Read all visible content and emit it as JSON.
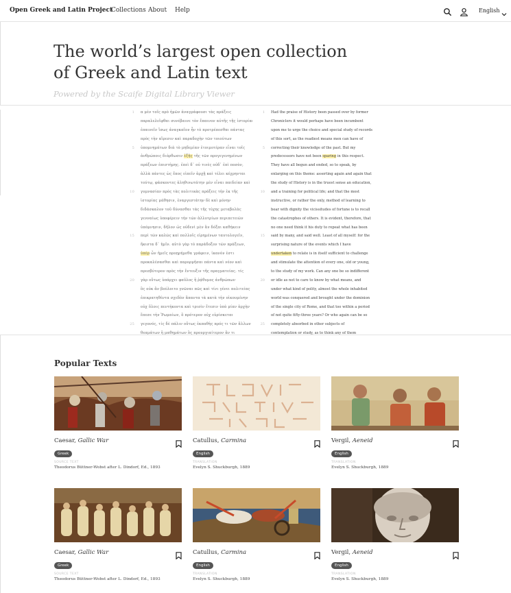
{
  "header": {
    "brand": "Open Greek and Latin Project",
    "nav": [
      "Collections",
      "About",
      "Help"
    ],
    "language": "English"
  },
  "hero": {
    "title": "The world’s largest open collection of Greek and Latin text",
    "subtitle": "Powered by the Scaife Digital Library Viewer"
  },
  "reader": {
    "greek_lines": [
      {
        "n": "1",
        "t": "α μὲν τοῖς πρὸ ἡμῶν ἀναγράφουσι τὰς πράξεις"
      },
      {
        "n": "",
        "t": "παραλελεῖφθαι συνέβαινε τὸν ἔπαινον αὐτῆς τῆς ἱστορίας"
      },
      {
        "n": "",
        "t": "ἐπαινεῖν ἴσως ἀναγκαῖον ἦν τὸ προτρέπεσθαι πάντας"
      },
      {
        "n": "",
        "t": "πρὸς τὴν αἵρεσιν καὶ παραδοχὴν τῶν τοιούτων"
      },
      {
        "n": "5",
        "t": "ὑπομνημάτων διὰ τὸ μηδεμίαν ἑτοιμοτέραν εἶναι τοῖς"
      },
      {
        "n": "",
        "t": "ἀνθρώποις διόρθωσιν",
        "h": "ἐξῆς",
        "t2": "τῆς τῶν προγεγενημένων"
      },
      {
        "n": "",
        "t": "πράξεων ἐπιστήμης. ἐπεὶ δ᾽ οὐ τινὲς οὐδ᾽ ἐπὶ ποσὸν,"
      },
      {
        "n": "",
        "t": "ἀλλὰ πάντες ὡς ἔπος εἰπεῖν ἀρχῇ καὶ τέλει κέχρηνται"
      },
      {
        "n": "",
        "t": "τούτῳ, φάσκοντες ἀληθινωτάτην μὲν εἶναι παιδείαν καὶ"
      },
      {
        "n": "10",
        "t": "γυμνασίαν πρὸς τὰς πολιτικὰς πράξεις τὴν ἐκ τῆς"
      },
      {
        "n": "",
        "t": "ἱστορίας μάθησιν, ἐναργεστάτην δὲ καὶ μόνην"
      },
      {
        "n": "",
        "t": "διδάσκαλον τοῦ δύνασθαι τὰς τῆς τύχης μεταβολὰς"
      },
      {
        "n": "",
        "t": "γενναίως ὑποφέρειν τὴν τῶν ἀλλοτρίων περιπετειῶν"
      },
      {
        "n": "",
        "t": "ὑπόμνησιν, δῆλον ὡς οὐδενὶ μὲν ἂν δόξαι καθήκειν"
      },
      {
        "n": "15",
        "t": "περὶ τῶν καλῶς καὶ πολλοῖς εἰρημένων ταυτολογεῖν,"
      },
      {
        "n": "",
        "t": "ἥκιστα δ᾽ ἡμῖν. αὐτὸ γὰρ τὸ παράδοξον τῶν πράξεων,"
      },
      {
        "n": "",
        "t": "",
        "h": "ὑπὲρ",
        "t2": "ὧν ἡμεῖς προῃρήμεθα γράφειν, ἱκανόν ἐστι"
      },
      {
        "n": "",
        "t": "προκαλέσασθαι καὶ παρορμῆσαι πάντα καὶ νέον καὶ"
      },
      {
        "n": "",
        "t": "πρεσβύτερον πρὸς τὴν ἔντευξιν τῆς πραγματείας. τίς"
      },
      {
        "n": "20",
        "t": "γὰρ οὕτως ὑπάρχει φαῦλος ἢ ῥᾴθυμος ἀνθρώπων"
      },
      {
        "n": "",
        "t": "ὃς οὐκ ἂν βούλοιτο γνῶναι πῶς καὶ τίνι γένει πολιτείας"
      },
      {
        "n": "",
        "t": "ἐπικρατηθέντα σχεδὸν ἅπαντα τὰ κατὰ τὴν οἰκουμένην"
      },
      {
        "n": "",
        "t": "οὐχ ὅλοις πεντήκοντα καὶ τρισὶν ἔτεσιν ὑπὸ μίαν ἀρχὴν"
      },
      {
        "n": "",
        "t": "ἔπεσε τὴν Ῥωμαίων, ὃ πρότερον οὐχ εὑρίσκεται"
      },
      {
        "n": "25",
        "t": "γεγονός, τίς δὲ πάλιν οὕτως ἐκπαθὴς πρός τι τῶν ἄλλων"
      },
      {
        "n": "",
        "t": "θεαμάτων ἢ μαθημάτων ὃς προυργιαίτερον ἄν τι"
      }
    ],
    "english_lines": [
      {
        "n": "1",
        "t": "Had the praise of History been passed over by former"
      },
      {
        "n": "",
        "t": "Chroniclers it would perhaps have been incumbent"
      },
      {
        "n": "",
        "t": "upon me to urge the choice and special study of records"
      },
      {
        "n": "",
        "t": "of this sort, as the readiest means men can have of"
      },
      {
        "n": "5",
        "t": "correcting their knowledge of the past. But my"
      },
      {
        "n": "",
        "t": "predecessors have not been",
        "h": "sparing",
        "t2": "in this respect."
      },
      {
        "n": "",
        "t": "They have all begun and ended, so to speak, by"
      },
      {
        "n": "",
        "t": "enlarging on this theme: asserting again and again that"
      },
      {
        "n": "",
        "t": "the study of History is in the truest sense an education,"
      },
      {
        "n": "10",
        "t": "and a training for political life; and that the most"
      },
      {
        "n": "",
        "t": "instructive, or rather the only, method of learning to"
      },
      {
        "n": "",
        "t": "bear with dignity the vicissitudes of fortune is to recall"
      },
      {
        "n": "",
        "t": "the catastrophes of others. It is evident, therefore, that"
      },
      {
        "n": "",
        "t": "no one need think it his duty to repeat what has been"
      },
      {
        "n": "15",
        "t": "said by many, and said well. Least of all myself: for the"
      },
      {
        "n": "",
        "t": "surprising nature of the events which I have"
      },
      {
        "n": "",
        "t": "",
        "h": "undertaken",
        "t2": "to relate is in itself sufficient to challenge"
      },
      {
        "n": "",
        "t": "and stimulate the attention of every one, old or young,"
      },
      {
        "n": "",
        "t": "to the study of my work. Can any one be so indifferent"
      },
      {
        "n": "20",
        "t": "or idle as not to care to know by what means, and"
      },
      {
        "n": "",
        "t": "under what kind of polity, almost the whole inhabited"
      },
      {
        "n": "",
        "t": "world was conquered and brought under the dominion"
      },
      {
        "n": "",
        "t": "of the single city of Rome, and that too within a period"
      },
      {
        "n": "",
        "t": "of not quite fifty-three years? Or who again can be so"
      },
      {
        "n": "25",
        "t": "completely absorbed in other subjects of"
      },
      {
        "n": "",
        "t": "contemplation or study, as to think any of them"
      }
    ]
  },
  "popular": {
    "title": "Popular Texts",
    "cards": [
      {
        "author": "Caesar, ",
        "work": "Gallic War",
        "lang": "Greek",
        "label": "SOURCE TEXT",
        "credit": "Theodorus Büttner-Wobst after L. Dindorf, Ed., 1893",
        "img": "battle"
      },
      {
        "author": "Catullus, ",
        "work": "Carmina",
        "lang": "English",
        "label": "TRANSLATION",
        "credit": "Evelyn S. Shuckburgh, 1889",
        "img": "inscription"
      },
      {
        "author": "Vergil, ",
        "work": "Aeneid",
        "lang": "English",
        "label": "TRANSLATION",
        "credit": "Evelyn S. Shuckburgh, 1889",
        "img": "fresco"
      },
      {
        "author": "Caesar, ",
        "work": "Gallic War",
        "lang": "Greek",
        "label": "SOURCE TEXT",
        "credit": "Theodorus Büttner-Wobst after L. Dindorf, Ed., 1893",
        "img": "senate"
      },
      {
        "author": "Catullus, ",
        "work": "Carmina",
        "lang": "English",
        "label": "TRANSLATION",
        "credit": "Evelyn S. Shuckburgh, 1889",
        "img": "chariot"
      },
      {
        "author": "Vergil, ",
        "work": "Aeneid",
        "lang": "English",
        "label": "TRANSLATION",
        "credit": "Evelyn S. Shuckburgh, 1889",
        "img": "bust"
      }
    ]
  }
}
